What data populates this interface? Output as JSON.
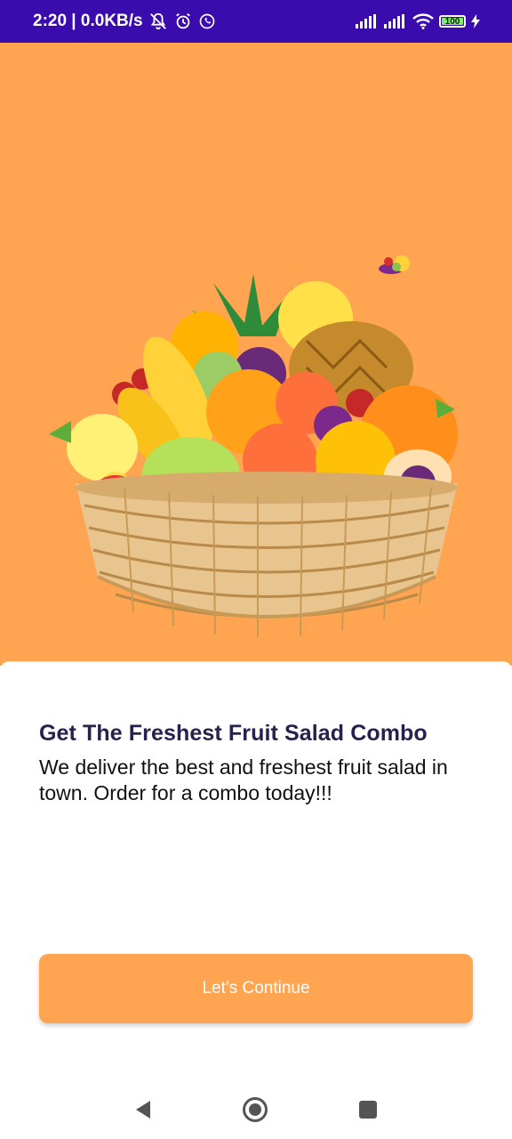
{
  "status_bar": {
    "time_speed": "2:20 | 0.0KB/s",
    "battery_level": "100",
    "icons": [
      "mute-bell-icon",
      "alarm-icon",
      "whatsapp-icon",
      "signal-icon",
      "signal-icon",
      "wifi-icon",
      "battery-icon",
      "charging-icon"
    ]
  },
  "hero": {
    "background_color": "#ffa451",
    "illustration": "fruit-basket-illustration"
  },
  "onboarding": {
    "headline": "Get The Freshest Fruit Salad Combo",
    "description": "We deliver the best and freshest fruit salad in town. Order for a combo today!!!",
    "cta_label": "Let’s Continue"
  },
  "colors": {
    "accent": "#ffa451",
    "status_bar": "#3a0cad",
    "headline": "#27214d"
  },
  "nav_bar": {
    "icons": [
      "back-icon",
      "home-icon",
      "recents-icon"
    ]
  }
}
